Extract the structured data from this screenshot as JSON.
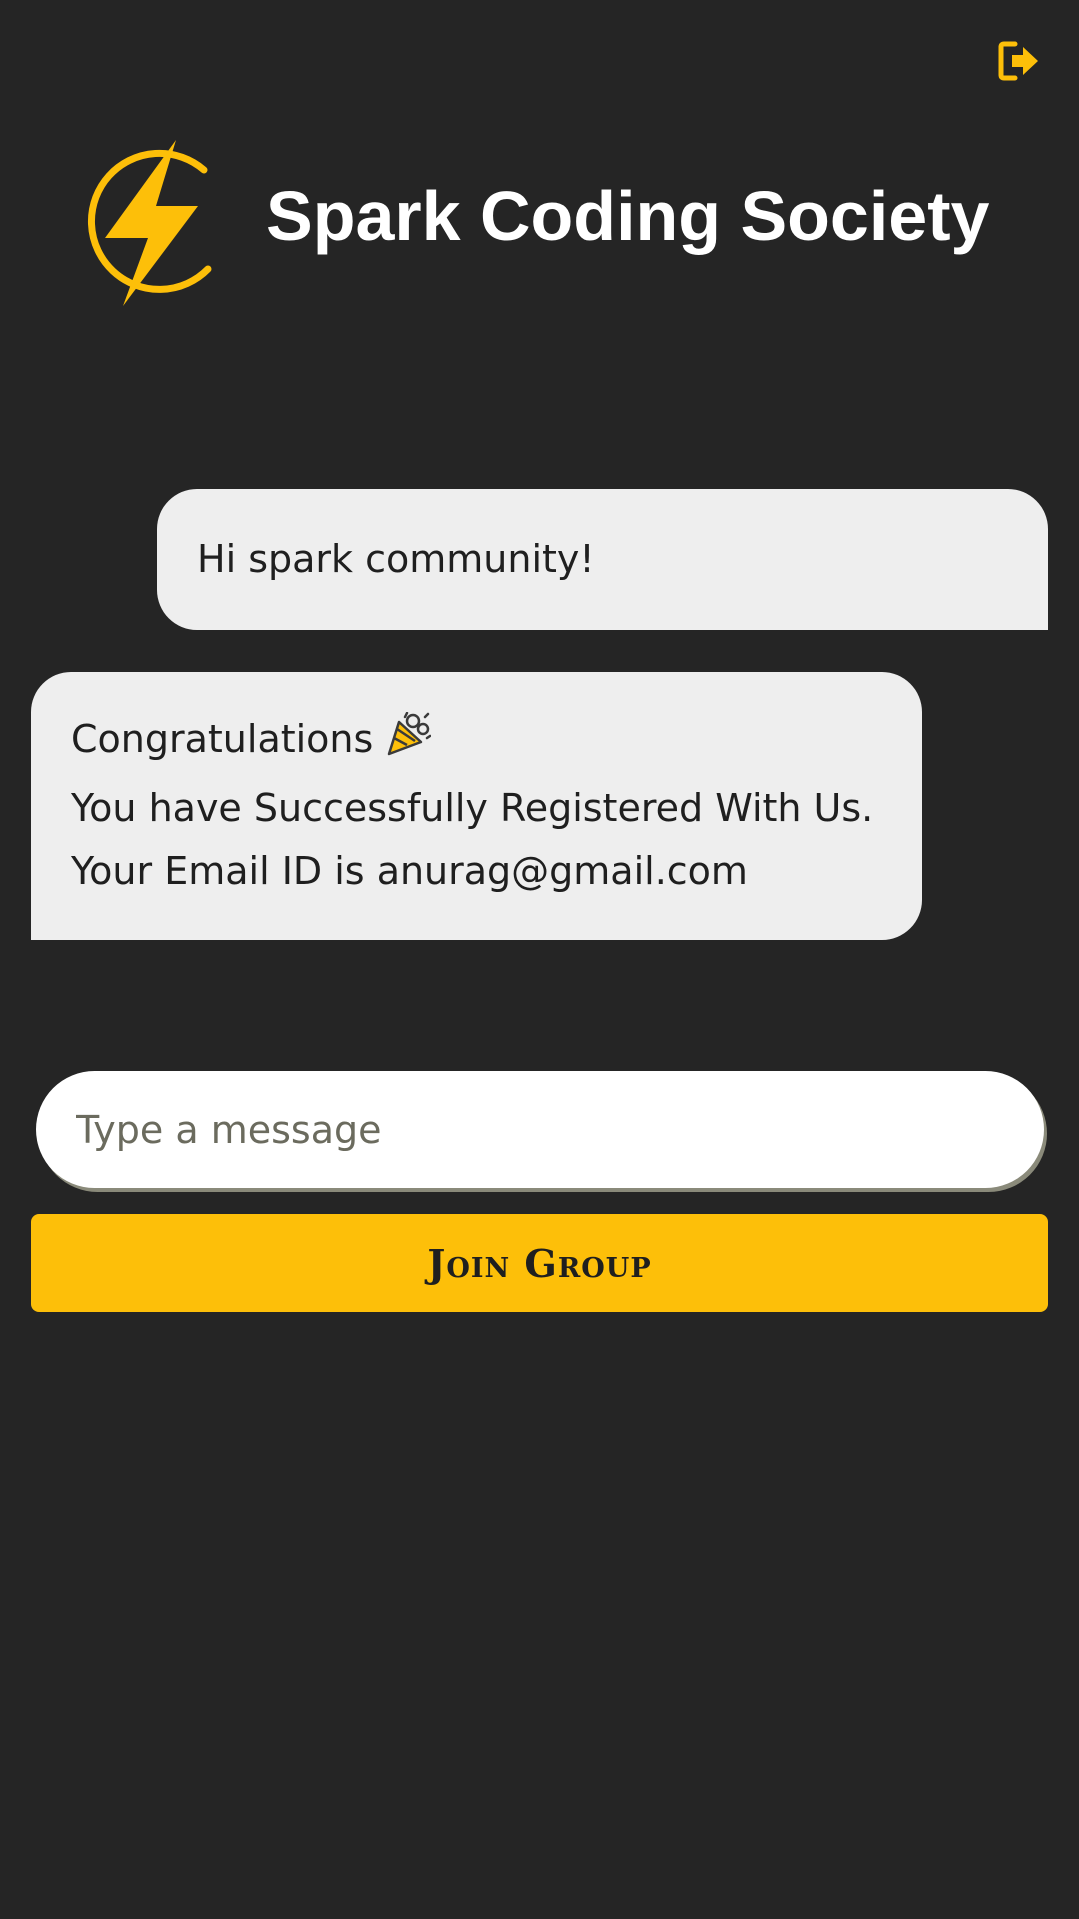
{
  "app": {
    "title": "Spark Coding Society",
    "accent_color": "#fdbf09",
    "background_color": "#252525",
    "logo_icon": "lightning-bolt-logo-icon",
    "logout_icon": "sign-out-icon"
  },
  "messages": [
    {
      "direction": "sent",
      "text": "Hi spark community!"
    },
    {
      "direction": "received",
      "lines": [
        "Congratulations",
        "You have Successfully Registered With Us.",
        "Your Email ID is anurag@gmail.com"
      ],
      "emoji_icon": "party-popper-icon"
    }
  ],
  "composer": {
    "placeholder": "Type a message",
    "value": ""
  },
  "join_button": {
    "label": "Join Group"
  }
}
